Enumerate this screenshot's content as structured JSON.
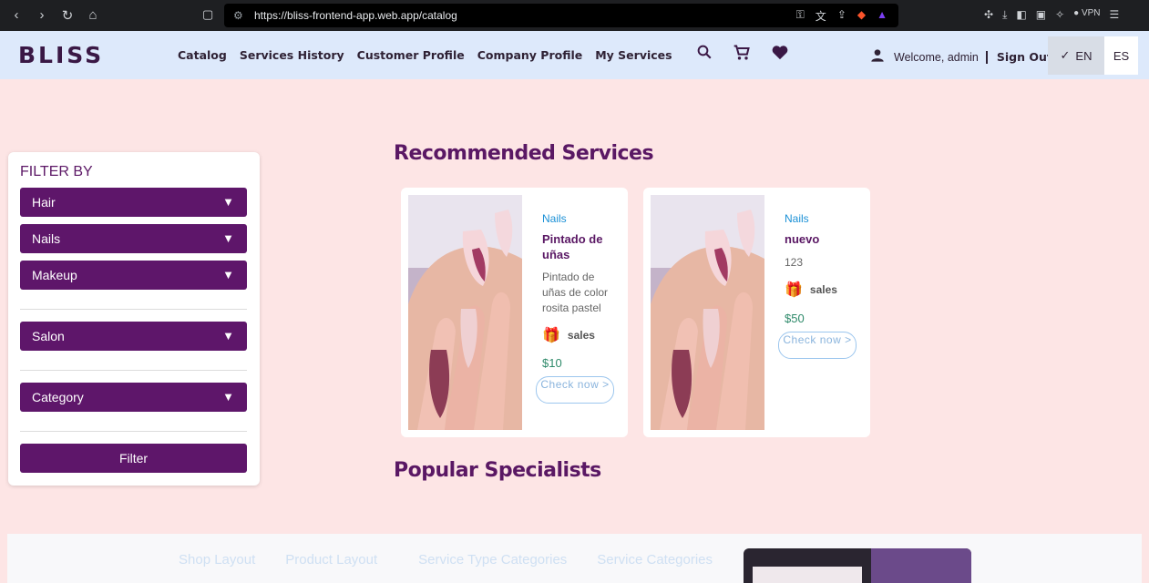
{
  "browser": {
    "url": "https://bliss-frontend-app.web.app/catalog",
    "vpn_label": "VPN"
  },
  "header": {
    "logo": "BLISS",
    "menu": [
      "Catalog",
      "Services History",
      "Customer Profile",
      "Company Profile",
      "My Services"
    ],
    "welcome": "Welcome, admin",
    "sign_out": "Sign Out",
    "lang_en": "EN",
    "lang_es": "ES"
  },
  "filter": {
    "title": "FILTER BY",
    "selects": [
      "Hair",
      "Nails",
      "Makeup",
      "Salon",
      "Category"
    ],
    "button": "Filter"
  },
  "recommended": {
    "title": "Recommended Services",
    "cards": [
      {
        "category": "Nails",
        "name": "Pintado de uñas",
        "description": "Pintado de uñas de color rosita pastel",
        "sales": "sales",
        "price": "$10",
        "cta": "Check now >"
      },
      {
        "category": "Nails",
        "name": "nuevo",
        "description": "123",
        "sales": "sales",
        "price": "$50",
        "cta": "Check now >"
      }
    ]
  },
  "popular": {
    "title": "Popular Specialists"
  },
  "footer": {
    "links": [
      "Shop Layout",
      "Product Layout",
      "Service Type Categories",
      "Service Categories"
    ]
  },
  "colors": {
    "brand": "#5e166a",
    "header_bg": "#dde9fb",
    "page_bg": "#fde5e5"
  }
}
